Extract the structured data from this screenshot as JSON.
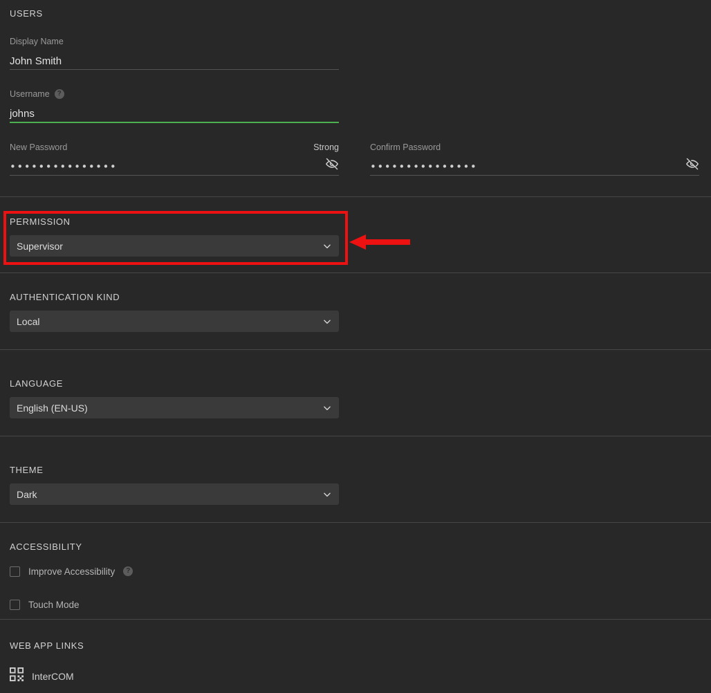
{
  "page": {
    "background_color": "#282828",
    "panel_color": "#3a3a3a",
    "accent_green": "#4caf50",
    "annotation_color": "#ee1111"
  },
  "users": {
    "header": "USERS",
    "fields": {
      "display_name": {
        "label": "Display Name",
        "value": "John Smith",
        "placeholder": "Display Name"
      },
      "username": {
        "label": "Username",
        "value": "johns",
        "placeholder": "Username",
        "help_icon": "help-circle-icon",
        "help_glyph": "?",
        "focused": true
      },
      "new_password": {
        "label": "New Password",
        "strength": "Strong",
        "value": "•••••••••••••••",
        "placeholder": "New Password",
        "toggle_icon": "eye-off-icon"
      },
      "confirm_password": {
        "label": "Confirm Password",
        "value": "•••••••••••••••",
        "placeholder": "Confirm Password",
        "toggle_icon": "eye-off-icon"
      }
    }
  },
  "permission": {
    "title": "PERMISSION",
    "select": {
      "value": "Supervisor",
      "chevron_icon": "chevron-down-icon"
    }
  },
  "authentication_kind": {
    "title": "AUTHENTICATION KIND",
    "select": {
      "value": "Local",
      "chevron_icon": "chevron-down-icon"
    }
  },
  "language": {
    "title": "LANGUAGE",
    "select": {
      "value": "English (EN-US)",
      "chevron_icon": "chevron-down-icon"
    }
  },
  "theme": {
    "title": "THEME",
    "select": {
      "value": "Dark",
      "chevron_icon": "chevron-down-icon"
    }
  },
  "accessibility": {
    "title": "ACCESSIBILITY",
    "options": [
      {
        "label": "Improve Accessibility",
        "checked": false,
        "help_icon": "help-circle-icon",
        "help_glyph": "?"
      },
      {
        "label": "Touch Mode",
        "checked": false
      }
    ]
  },
  "web_app_links": {
    "title": "WEB APP LINKS",
    "links": [
      {
        "label": "InterCOM",
        "icon": "qr-code-icon"
      }
    ]
  },
  "annotations": {
    "highlight_box": {
      "name": "permission-highlight-box",
      "target": "PERMISSION"
    },
    "arrow": {
      "name": "pointer-arrow",
      "direction": "left",
      "target": "PERMISSION"
    }
  }
}
